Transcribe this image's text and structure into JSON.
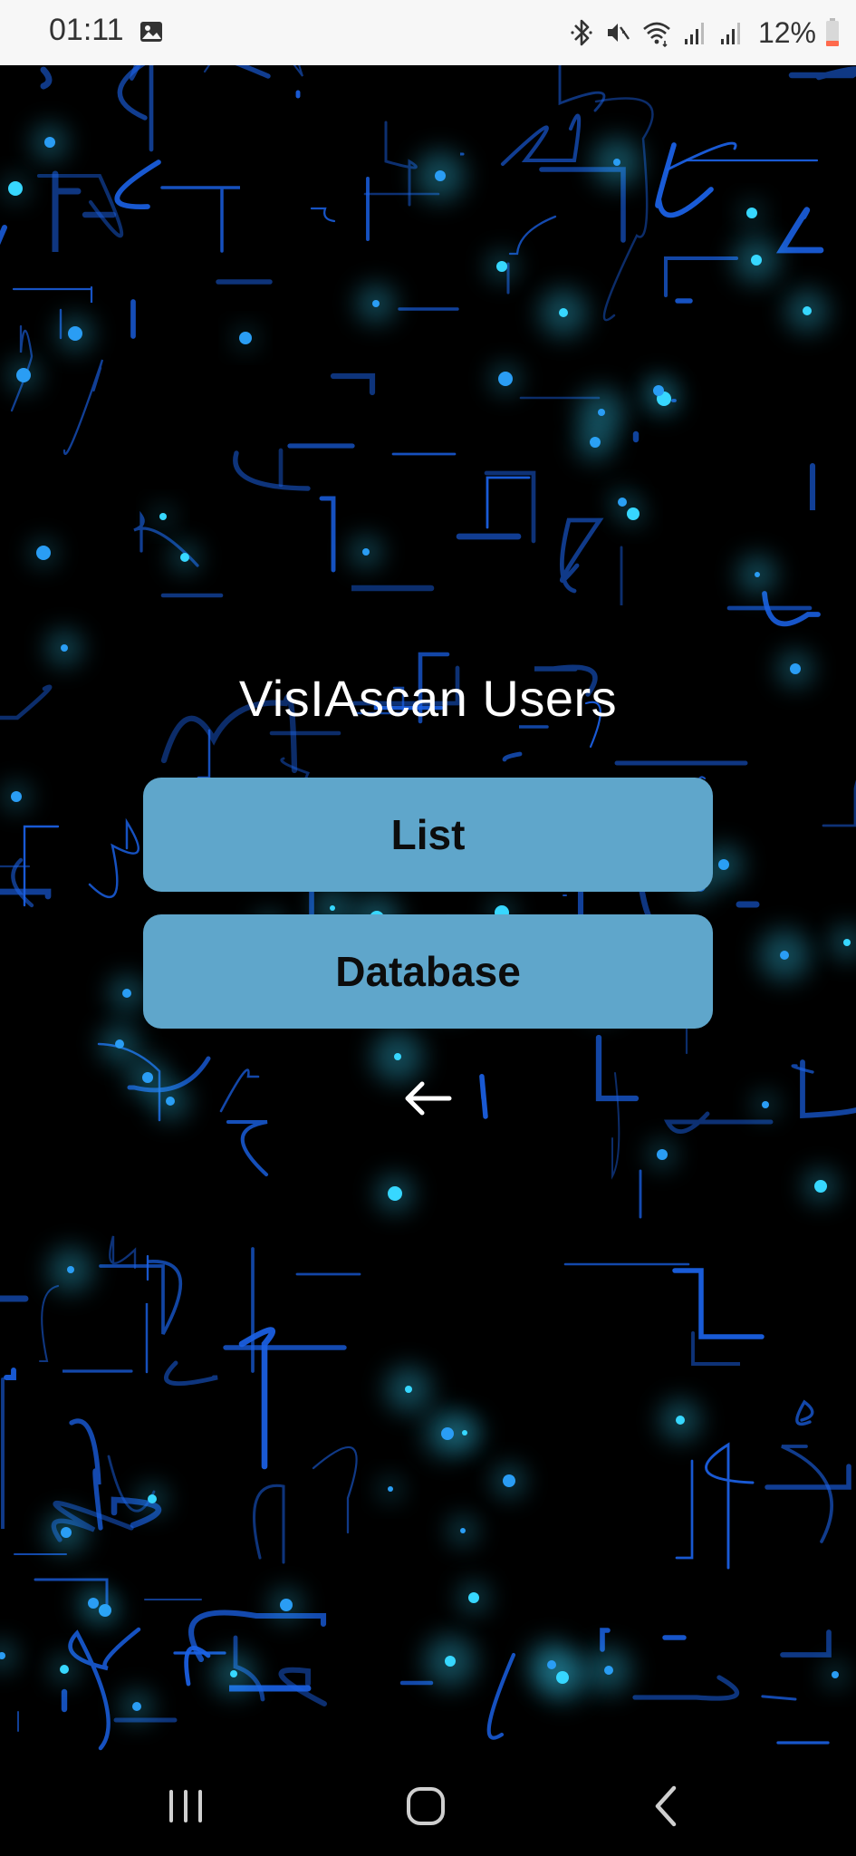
{
  "status_bar": {
    "time": "01:11",
    "battery_text": "12%",
    "icons": [
      "gallery-icon",
      "bluetooth-icon",
      "mute-icon",
      "wifi-icon",
      "signal-icon",
      "signal-icon",
      "battery-icon"
    ]
  },
  "app": {
    "title": "VisIAscan Users",
    "buttons": [
      {
        "label": "List"
      },
      {
        "label": "Database"
      }
    ],
    "back_icon": "arrow-left-icon"
  },
  "nav_bar": {
    "items": [
      "recents-icon",
      "home-icon",
      "back-icon"
    ]
  },
  "colors": {
    "button_bg": "#5fa6cb",
    "button_text": "#0c0c0c",
    "title_text": "#ffffff",
    "background": "#000000",
    "status_bar_bg": "#f7f7f7",
    "circuit_blue": "#1e6cff",
    "circuit_glow": "#37d7ff",
    "battery_low": "#ff6a4d"
  }
}
